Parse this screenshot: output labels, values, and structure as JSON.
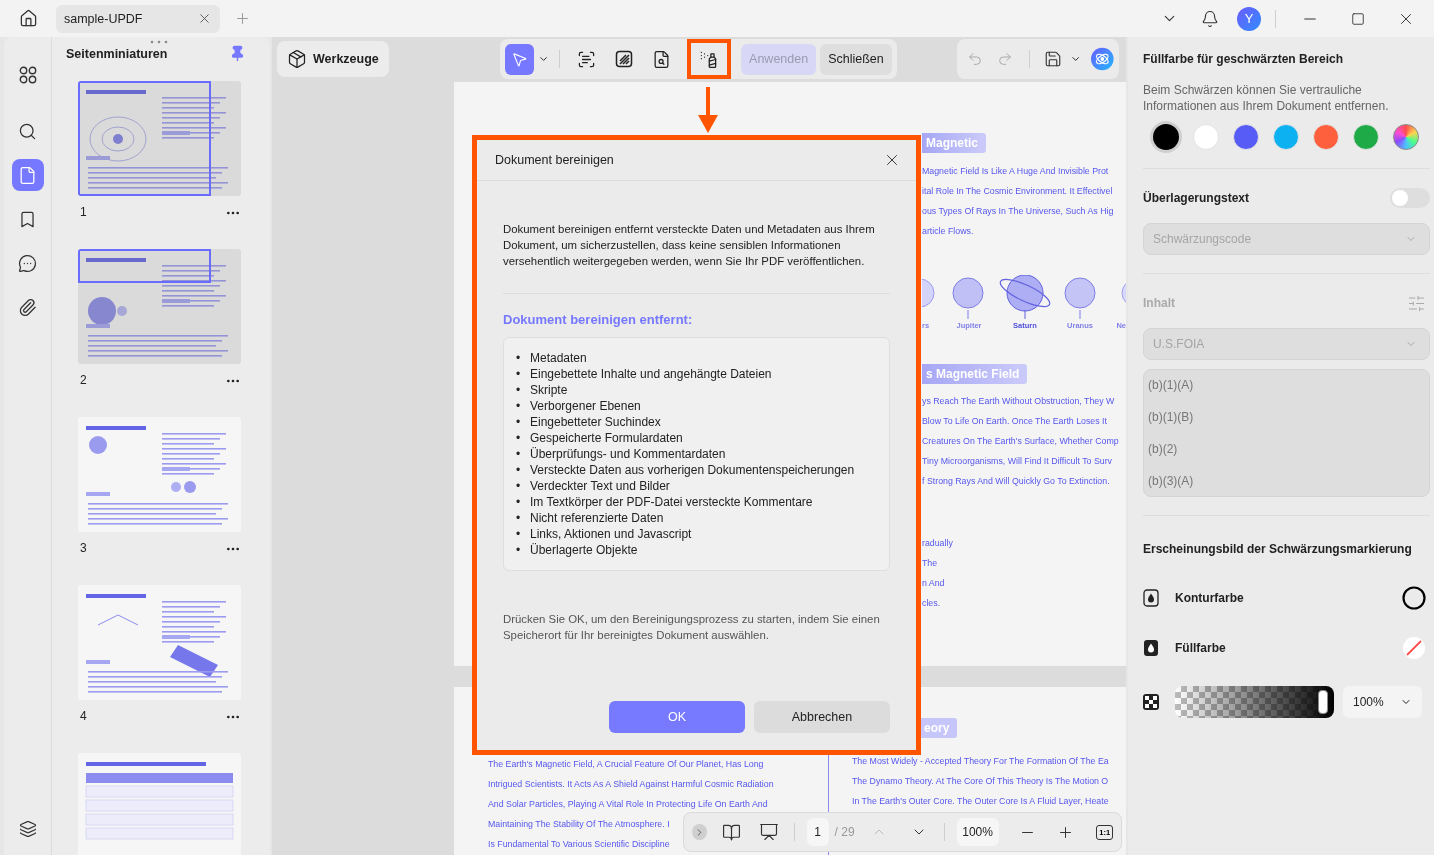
{
  "title_bar": {
    "tab": {
      "title": "sample-UPDF"
    },
    "avatar": "Y"
  },
  "rail": [
    {
      "selected": false
    },
    {
      "selected": false
    },
    {
      "selected": true
    },
    {
      "selected": false
    },
    {
      "selected": false
    },
    {
      "selected": false
    }
  ],
  "sidebar": {
    "title": "Seitenminiaturen",
    "thumbnails": [
      {
        "label": "1",
        "in_view": true
      },
      {
        "label": "2",
        "in_view": true
      },
      {
        "label": "3",
        "in_view": false
      },
      {
        "label": "4",
        "in_view": false
      },
      {
        "in_view": false
      }
    ]
  },
  "toolbar": {
    "tools_button": "Werkzeuge",
    "select_tool": {
      "selected": true
    },
    "tools": [
      {
        "annotated": false
      },
      {
        "annotated": false
      },
      {
        "annotated": false
      },
      {
        "annotated": true
      }
    ],
    "apply": {
      "label": "Anwenden",
      "disabled": true
    },
    "close": "Schließen",
    "undo": {
      "disabled": true
    },
    "redo": {
      "disabled": true
    }
  },
  "document": {
    "page_1": {
      "label_1": "Magnetic",
      "lines_1": [
        "Magnetic Field Is Like A Huge And Invisible Prot",
        "ital Role In The Cosmic Environment. It Effectivel",
        "ous Types Of Rays In The Universe, Such As Hig",
        "article Flows."
      ],
      "planets": [
        "rs",
        "Jupiter",
        "Saturn",
        "Uranus",
        "Ne"
      ],
      "label_2": "s Magnetic Field",
      "lines_2": [
        "ys Reach The Earth Without Obstruction, They W",
        "Blow To Life On Earth. Once The Earth Loses It",
        "Creatures On The Earth's Surface, Whether Comp",
        "Tiny Microorganisms, Will Find It Difficult To Surv",
        "f Strong Rays And Will Quickly Go To Extinction."
      ],
      "lines_3": [
        "radually",
        "The",
        "n And",
        "cles."
      ]
    },
    "page_2": {
      "left_lines": [
        "The Earth's Magnetic Field, A Crucial Feature Of Our Planet, Has Long",
        "Intrigued Scientists. It Acts As A Shield Against Harmful Cosmic Radiation",
        "And Solar Particles, Playing A Vital Role In Protecting Life On Earth And",
        "Maintaining The Stability Of The Atmosphere. I",
        "Is Fundamental To Various Scientific Discipline"
      ],
      "label": "eory",
      "right_lines": [
        "The Most Widely - Accepted Theory For The Formation Of The Ea",
        "The Dynamo Theory. At The Core Of This Theory Is The Motion O",
        "In The Earth's Outer Core. The Outer Core Is A Fluid Layer, Heate"
      ]
    }
  },
  "dialog": {
    "title": "Dokument bereinigen",
    "intro": "Dokument bereinigen entfernt versteckte Daten und Metadaten aus Ihrem Dokument, um sicherzustellen, dass keine sensiblen Informationen versehentlich weitergegeben werden, wenn Sie Ihr PDF veröffentlichen.",
    "heading": "Dokument bereinigen entfernt:",
    "bullet": "•",
    "items": [
      "Metadaten",
      "Eingebettete Inhalte und angehängte Dateien",
      "Skripte",
      "Verborgener Ebenen",
      "Eingebetteter Suchindex",
      "Gespeicherte Formulardaten",
      "Überprüfungs- und Kommentardaten",
      "Versteckte Daten aus vorherigen Dokumentenspeicherungen",
      "Verdeckter Text und Bilder",
      "Im Textkörper der PDF-Datei versteckte Kommentare",
      "Nicht referenzierte Daten",
      "Links, Aktionen und Javascript",
      "Überlagerte Objekte"
    ],
    "footer": "Drücken Sie OK, um den Bereinigungsprozess zu starten, indem Sie einen Speicherort für Ihr bereinigtes Dokument auswählen.",
    "buttons": [
      {
        "label": "OK",
        "primary": true
      },
      {
        "label": "Abbrechen",
        "primary": false
      }
    ]
  },
  "page_nav": {
    "page": "1",
    "total": "/ 29",
    "zoom": "100%",
    "actual_size": "1:1",
    "previous_disabled": true
  },
  "right_panel": {
    "fill_title": "Füllfarbe für geschwärzten Bereich",
    "fill_description": "Beim Schwärzen können Sie vertrauliche Informationen aus Ihrem Dokument entfernen.",
    "swatches": [
      {
        "kind": "solid",
        "color": "#000000",
        "selected": true
      },
      {
        "kind": "solid",
        "color": "#ffffff",
        "selected": false
      },
      {
        "kind": "solid",
        "color": "#575cf7",
        "selected": false
      },
      {
        "kind": "solid",
        "color": "#0cb1f2",
        "selected": false
      },
      {
        "kind": "solid",
        "color": "#fe5f3d",
        "selected": false
      },
      {
        "kind": "solid",
        "color": "#1faa48",
        "selected": false
      },
      {
        "kind": "spectrum",
        "selected": false
      }
    ],
    "overlay": {
      "label": "Überlagerungstext",
      "on": false,
      "select": "Schwärzungscode"
    },
    "content": {
      "label": "Inhalt",
      "disabled": true,
      "select": "U.S.FOIA",
      "codes": [
        "(b)(1)(A)",
        "(b)(1)(B)",
        "(b)(2)",
        "(b)(3)(A)"
      ]
    },
    "appearance": {
      "title": "Erscheinungsbild der Schwärzungsmarkierung",
      "outline": "Konturfarbe",
      "fill": "Füllfarbe",
      "opacity": {
        "level": 1,
        "value": "100%"
      }
    }
  }
}
